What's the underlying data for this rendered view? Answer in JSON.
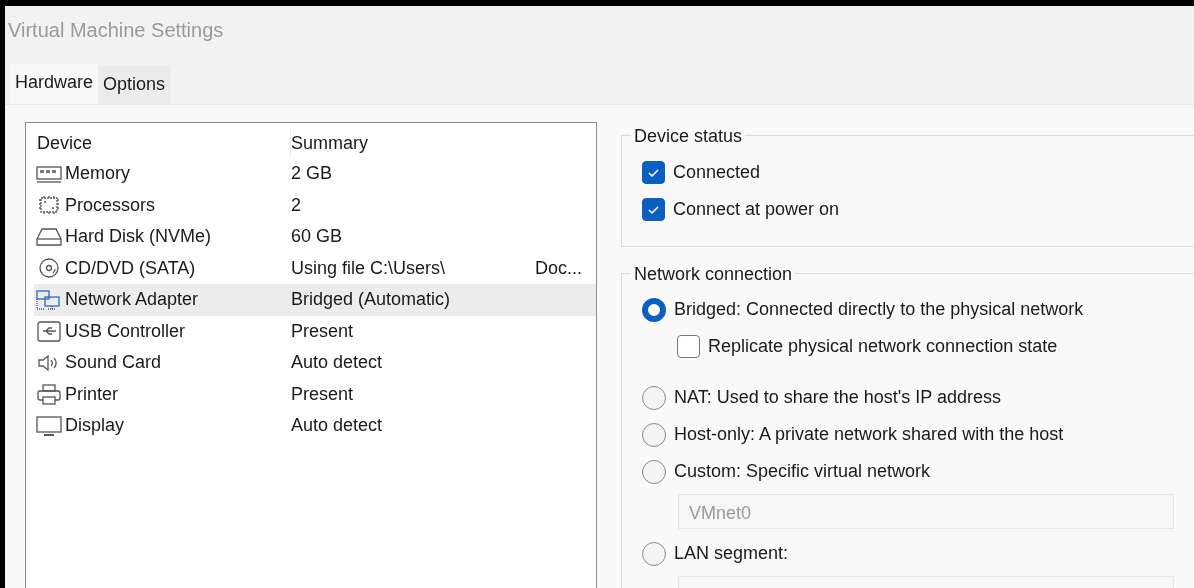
{
  "window": {
    "title": "Virtual Machine Settings"
  },
  "tabs": [
    {
      "label": "Hardware",
      "selected": true
    },
    {
      "label": "Options",
      "selected": false
    }
  ],
  "device_table": {
    "columns": [
      "Device",
      "Summary"
    ],
    "rows": [
      {
        "kind": "memory",
        "device": "Memory",
        "summary": "2 GB",
        "selected": false
      },
      {
        "kind": "processor",
        "device": "Processors",
        "summary": "2",
        "selected": false
      },
      {
        "kind": "disk",
        "device": "Hard Disk (NVMe)",
        "summary": "60 GB",
        "selected": false
      },
      {
        "kind": "cd",
        "device": "CD/DVD (SATA)",
        "summary": "Using file C:\\Users\\",
        "summary_tail": "Doc...",
        "selected": false
      },
      {
        "kind": "network",
        "device": "Network Adapter",
        "summary": "Bridged (Automatic)",
        "selected": true
      },
      {
        "kind": "usb",
        "device": "USB Controller",
        "summary": "Present",
        "selected": false
      },
      {
        "kind": "sound",
        "device": "Sound Card",
        "summary": "Auto detect",
        "selected": false
      },
      {
        "kind": "printer",
        "device": "Printer",
        "summary": "Present",
        "selected": false
      },
      {
        "kind": "display",
        "device": "Display",
        "summary": "Auto detect",
        "selected": false
      }
    ]
  },
  "device_status": {
    "title": "Device status",
    "options": [
      {
        "label": "Connected",
        "checked": true
      },
      {
        "label": "Connect at power on",
        "checked": true
      }
    ]
  },
  "network_connection": {
    "title": "Network connection",
    "options": [
      {
        "label": "Bridged: Connected directly to the physical network",
        "selected": true,
        "children": [
          {
            "label": "Replicate physical network connection state",
            "checked": false
          }
        ]
      },
      {
        "label": "NAT: Used to share the host's IP address",
        "selected": false
      },
      {
        "label": "Host-only: A private network shared with the host",
        "selected": false
      },
      {
        "label": "Custom: Specific virtual network",
        "selected": false,
        "field": {
          "value": "VMnet0",
          "disabled": true
        }
      },
      {
        "label": "LAN segment:",
        "selected": false,
        "field": {
          "disabled": true
        }
      }
    ]
  }
}
